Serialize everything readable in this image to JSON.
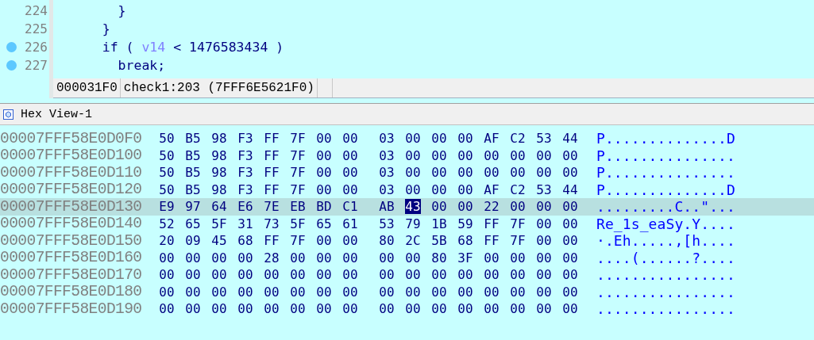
{
  "code": {
    "lines": [
      {
        "number": "224",
        "breakpoint": false,
        "tokens": [
          {
            "kind": "plain",
            "text": "      }"
          }
        ]
      },
      {
        "number": "225",
        "breakpoint": false,
        "tokens": [
          {
            "kind": "plain",
            "text": "    }"
          }
        ]
      },
      {
        "number": "226",
        "breakpoint": true,
        "tokens": [
          {
            "kind": "plain",
            "text": "    if ( "
          },
          {
            "kind": "var",
            "text": "v14"
          },
          {
            "kind": "plain",
            "text": " < 1476583434 )"
          }
        ]
      },
      {
        "number": "227",
        "breakpoint": true,
        "tokens": [
          {
            "kind": "plain",
            "text": "      break;"
          }
        ]
      }
    ]
  },
  "status": {
    "offset": "000031F0",
    "location": "check1:203 (7FFF6E5621F0)"
  },
  "hex_view": {
    "title": "Hex View-1",
    "rows": [
      {
        "address": "00007FFF58E0D0F0",
        "selected": false,
        "bytes": [
          {
            "value": "50",
            "selected": false
          },
          {
            "value": "B5",
            "selected": false
          },
          {
            "value": "98",
            "selected": false
          },
          {
            "value": "F3",
            "selected": false
          },
          {
            "value": "FF",
            "selected": false
          },
          {
            "value": "7F",
            "selected": false
          },
          {
            "value": "00",
            "selected": false
          },
          {
            "value": "00",
            "selected": false
          },
          {
            "value": "03",
            "selected": false
          },
          {
            "value": "00",
            "selected": false
          },
          {
            "value": "00",
            "selected": false
          },
          {
            "value": "00",
            "selected": false
          },
          {
            "value": "AF",
            "selected": false
          },
          {
            "value": "C2",
            "selected": false
          },
          {
            "value": "53",
            "selected": false
          },
          {
            "value": "44",
            "selected": false
          }
        ],
        "ascii": "P..............D"
      },
      {
        "address": "00007FFF58E0D100",
        "selected": false,
        "bytes": [
          {
            "value": "50",
            "selected": false
          },
          {
            "value": "B5",
            "selected": false
          },
          {
            "value": "98",
            "selected": false
          },
          {
            "value": "F3",
            "selected": false
          },
          {
            "value": "FF",
            "selected": false
          },
          {
            "value": "7F",
            "selected": false
          },
          {
            "value": "00",
            "selected": false
          },
          {
            "value": "00",
            "selected": false
          },
          {
            "value": "03",
            "selected": false
          },
          {
            "value": "00",
            "selected": false
          },
          {
            "value": "00",
            "selected": false
          },
          {
            "value": "00",
            "selected": false
          },
          {
            "value": "00",
            "selected": false
          },
          {
            "value": "00",
            "selected": false
          },
          {
            "value": "00",
            "selected": false
          },
          {
            "value": "00",
            "selected": false
          }
        ],
        "ascii": "P..............."
      },
      {
        "address": "00007FFF58E0D110",
        "selected": false,
        "bytes": [
          {
            "value": "50",
            "selected": false
          },
          {
            "value": "B5",
            "selected": false
          },
          {
            "value": "98",
            "selected": false
          },
          {
            "value": "F3",
            "selected": false
          },
          {
            "value": "FF",
            "selected": false
          },
          {
            "value": "7F",
            "selected": false
          },
          {
            "value": "00",
            "selected": false
          },
          {
            "value": "00",
            "selected": false
          },
          {
            "value": "03",
            "selected": false
          },
          {
            "value": "00",
            "selected": false
          },
          {
            "value": "00",
            "selected": false
          },
          {
            "value": "00",
            "selected": false
          },
          {
            "value": "00",
            "selected": false
          },
          {
            "value": "00",
            "selected": false
          },
          {
            "value": "00",
            "selected": false
          },
          {
            "value": "00",
            "selected": false
          }
        ],
        "ascii": "P..............."
      },
      {
        "address": "00007FFF58E0D120",
        "selected": false,
        "bytes": [
          {
            "value": "50",
            "selected": false
          },
          {
            "value": "B5",
            "selected": false
          },
          {
            "value": "98",
            "selected": false
          },
          {
            "value": "F3",
            "selected": false
          },
          {
            "value": "FF",
            "selected": false
          },
          {
            "value": "7F",
            "selected": false
          },
          {
            "value": "00",
            "selected": false
          },
          {
            "value": "00",
            "selected": false
          },
          {
            "value": "03",
            "selected": false
          },
          {
            "value": "00",
            "selected": false
          },
          {
            "value": "00",
            "selected": false
          },
          {
            "value": "00",
            "selected": false
          },
          {
            "value": "AF",
            "selected": false
          },
          {
            "value": "C2",
            "selected": false
          },
          {
            "value": "53",
            "selected": false
          },
          {
            "value": "44",
            "selected": false
          }
        ],
        "ascii": "P..............D"
      },
      {
        "address": "00007FFF58E0D130",
        "selected": true,
        "bytes": [
          {
            "value": "E9",
            "selected": false
          },
          {
            "value": "97",
            "selected": false
          },
          {
            "value": "64",
            "selected": false
          },
          {
            "value": "E6",
            "selected": false
          },
          {
            "value": "7E",
            "selected": false
          },
          {
            "value": "EB",
            "selected": false
          },
          {
            "value": "BD",
            "selected": false
          },
          {
            "value": "C1",
            "selected": false
          },
          {
            "value": "AB",
            "selected": false
          },
          {
            "value": "43",
            "selected": true
          },
          {
            "value": "00",
            "selected": false
          },
          {
            "value": "00",
            "selected": false
          },
          {
            "value": "22",
            "selected": false
          },
          {
            "value": "00",
            "selected": false
          },
          {
            "value": "00",
            "selected": false
          },
          {
            "value": "00",
            "selected": false
          }
        ],
        "ascii": ".........C..\"..."
      },
      {
        "address": "00007FFF58E0D140",
        "selected": false,
        "bytes": [
          {
            "value": "52",
            "selected": false
          },
          {
            "value": "65",
            "selected": false
          },
          {
            "value": "5F",
            "selected": false
          },
          {
            "value": "31",
            "selected": false
          },
          {
            "value": "73",
            "selected": false
          },
          {
            "value": "5F",
            "selected": false
          },
          {
            "value": "65",
            "selected": false
          },
          {
            "value": "61",
            "selected": false
          },
          {
            "value": "53",
            "selected": false
          },
          {
            "value": "79",
            "selected": false
          },
          {
            "value": "1B",
            "selected": false
          },
          {
            "value": "59",
            "selected": false
          },
          {
            "value": "FF",
            "selected": false
          },
          {
            "value": "7F",
            "selected": false
          },
          {
            "value": "00",
            "selected": false
          },
          {
            "value": "00",
            "selected": false
          }
        ],
        "ascii": "Re_1s_eaSy.Y...."
      },
      {
        "address": "00007FFF58E0D150",
        "selected": false,
        "bytes": [
          {
            "value": "20",
            "selected": false
          },
          {
            "value": "09",
            "selected": false
          },
          {
            "value": "45",
            "selected": false
          },
          {
            "value": "68",
            "selected": false
          },
          {
            "value": "FF",
            "selected": false
          },
          {
            "value": "7F",
            "selected": false
          },
          {
            "value": "00",
            "selected": false
          },
          {
            "value": "00",
            "selected": false
          },
          {
            "value": "80",
            "selected": false
          },
          {
            "value": "2C",
            "selected": false
          },
          {
            "value": "5B",
            "selected": false
          },
          {
            "value": "68",
            "selected": false
          },
          {
            "value": "FF",
            "selected": false
          },
          {
            "value": "7F",
            "selected": false
          },
          {
            "value": "00",
            "selected": false
          },
          {
            "value": "00",
            "selected": false
          }
        ],
        "ascii": "·.Eh.....,[h...."
      },
      {
        "address": "00007FFF58E0D160",
        "selected": false,
        "bytes": [
          {
            "value": "00",
            "selected": false
          },
          {
            "value": "00",
            "selected": false
          },
          {
            "value": "00",
            "selected": false
          },
          {
            "value": "00",
            "selected": false
          },
          {
            "value": "28",
            "selected": false
          },
          {
            "value": "00",
            "selected": false
          },
          {
            "value": "00",
            "selected": false
          },
          {
            "value": "00",
            "selected": false
          },
          {
            "value": "00",
            "selected": false
          },
          {
            "value": "00",
            "selected": false
          },
          {
            "value": "80",
            "selected": false
          },
          {
            "value": "3F",
            "selected": false
          },
          {
            "value": "00",
            "selected": false
          },
          {
            "value": "00",
            "selected": false
          },
          {
            "value": "00",
            "selected": false
          },
          {
            "value": "00",
            "selected": false
          }
        ],
        "ascii": "....(......?...."
      },
      {
        "address": "00007FFF58E0D170",
        "selected": false,
        "bytes": [
          {
            "value": "00",
            "selected": false
          },
          {
            "value": "00",
            "selected": false
          },
          {
            "value": "00",
            "selected": false
          },
          {
            "value": "00",
            "selected": false
          },
          {
            "value": "00",
            "selected": false
          },
          {
            "value": "00",
            "selected": false
          },
          {
            "value": "00",
            "selected": false
          },
          {
            "value": "00",
            "selected": false
          },
          {
            "value": "00",
            "selected": false
          },
          {
            "value": "00",
            "selected": false
          },
          {
            "value": "00",
            "selected": false
          },
          {
            "value": "00",
            "selected": false
          },
          {
            "value": "00",
            "selected": false
          },
          {
            "value": "00",
            "selected": false
          },
          {
            "value": "00",
            "selected": false
          },
          {
            "value": "00",
            "selected": false
          }
        ],
        "ascii": "................"
      },
      {
        "address": "00007FFF58E0D180",
        "selected": false,
        "bytes": [
          {
            "value": "00",
            "selected": false
          },
          {
            "value": "00",
            "selected": false
          },
          {
            "value": "00",
            "selected": false
          },
          {
            "value": "00",
            "selected": false
          },
          {
            "value": "00",
            "selected": false
          },
          {
            "value": "00",
            "selected": false
          },
          {
            "value": "00",
            "selected": false
          },
          {
            "value": "00",
            "selected": false
          },
          {
            "value": "00",
            "selected": false
          },
          {
            "value": "00",
            "selected": false
          },
          {
            "value": "00",
            "selected": false
          },
          {
            "value": "00",
            "selected": false
          },
          {
            "value": "00",
            "selected": false
          },
          {
            "value": "00",
            "selected": false
          },
          {
            "value": "00",
            "selected": false
          },
          {
            "value": "00",
            "selected": false
          }
        ],
        "ascii": "................"
      },
      {
        "address": "00007FFF58E0D190",
        "selected": false,
        "bytes": [
          {
            "value": "00",
            "selected": false
          },
          {
            "value": "00",
            "selected": false
          },
          {
            "value": "00",
            "selected": false
          },
          {
            "value": "00",
            "selected": false
          },
          {
            "value": "00",
            "selected": false
          },
          {
            "value": "00",
            "selected": false
          },
          {
            "value": "00",
            "selected": false
          },
          {
            "value": "00",
            "selected": false
          },
          {
            "value": "00",
            "selected": false
          },
          {
            "value": "00",
            "selected": false
          },
          {
            "value": "00",
            "selected": false
          },
          {
            "value": "00",
            "selected": false
          },
          {
            "value": "00",
            "selected": false
          },
          {
            "value": "00",
            "selected": false
          },
          {
            "value": "00",
            "selected": false
          },
          {
            "value": "00",
            "selected": false
          }
        ],
        "ascii": "................"
      }
    ]
  }
}
